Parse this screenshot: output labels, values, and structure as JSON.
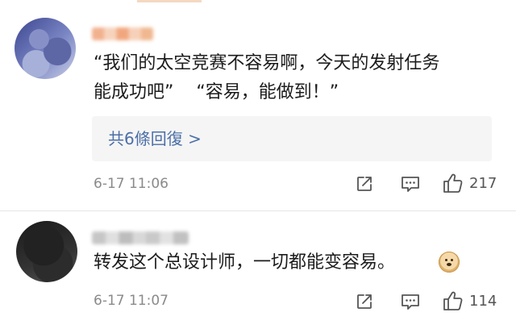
{
  "comments": [
    {
      "text_line1": "“我们的太空竞赛不容易啊，今天的发射任务",
      "text_line2": "能成功吧”    “容易，能做到！”",
      "reply_link": "共6條回復 >",
      "time": "6-17 11:06",
      "likes": "217",
      "share_icon": "share-icon",
      "comment_icon": "comment-icon",
      "like_icon": "thumbs-up-icon"
    },
    {
      "text": "转发这个总设计师，一切都能变容易。",
      "emoji": "doge-emoji",
      "time": "6-17 11:07",
      "likes": "114",
      "share_icon": "share-icon",
      "comment_icon": "comment-icon",
      "like_icon": "thumbs-up-icon"
    }
  ],
  "colors": {
    "link": "#4c6fa7",
    "meta_text": "#8a8a8a",
    "reply_box_bg": "#f5f5f5",
    "body_text": "#1c1c1c"
  }
}
